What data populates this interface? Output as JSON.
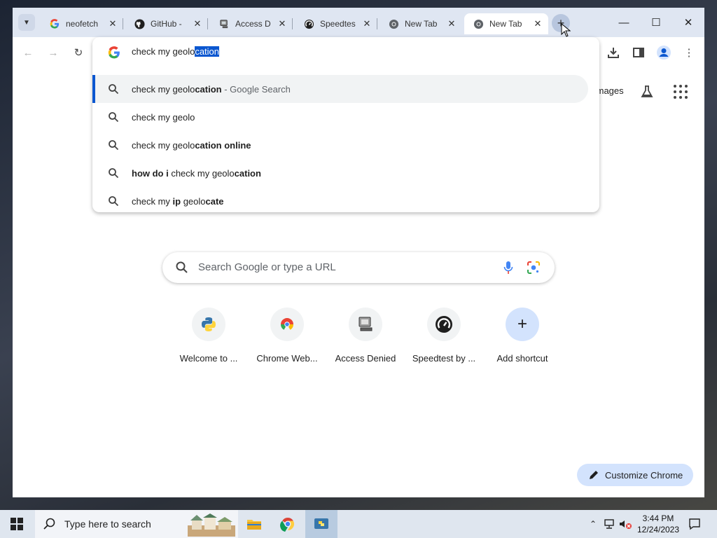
{
  "tabs": [
    {
      "title": "neofetch",
      "icon": "google-icon"
    },
    {
      "title": "GitHub -",
      "icon": "github-icon"
    },
    {
      "title": "Access D",
      "icon": "access-denied-icon"
    },
    {
      "title": "Speedtes",
      "icon": "speedtest-icon"
    },
    {
      "title": "New Tab",
      "icon": "chrome-icon"
    },
    {
      "title": "New Tab",
      "icon": "chrome-icon",
      "active": true
    }
  ],
  "omnibox": {
    "typed": "check my geolo",
    "autocomplete": "cation",
    "suggestions": [
      {
        "segments": [
          {
            "t": "check my geolo",
            "b": false
          },
          {
            "t": "cation",
            "b": true
          }
        ],
        "suffix": " - Google Search",
        "highlighted": true
      },
      {
        "segments": [
          {
            "t": "check my geolo",
            "b": false
          }
        ],
        "suffix": ""
      },
      {
        "segments": [
          {
            "t": "check my geolo",
            "b": false
          },
          {
            "t": "cation online",
            "b": true
          }
        ],
        "suffix": ""
      },
      {
        "segments": [
          {
            "t": "how do i",
            "b": true
          },
          {
            "t": " check my geolo",
            "b": false
          },
          {
            "t": "cation",
            "b": true
          }
        ],
        "suffix": ""
      },
      {
        "segments": [
          {
            "t": "check my ",
            "b": false
          },
          {
            "t": "ip",
            "b": true
          },
          {
            "t": " geolo",
            "b": false
          },
          {
            "t": "cate",
            "b": true
          }
        ],
        "suffix": ""
      }
    ]
  },
  "ntp": {
    "images_link": "Images",
    "search_placeholder": "Search Google or type a URL",
    "shortcuts": [
      {
        "label": "Welcome to ...",
        "icon": "python-icon"
      },
      {
        "label": "Chrome Web...",
        "icon": "chrome-web-store-icon"
      },
      {
        "label": "Access Denied",
        "icon": "access-denied-icon"
      },
      {
        "label": "Speedtest by ...",
        "icon": "speedtest-icon"
      },
      {
        "label": "Add shortcut",
        "icon": "plus-icon"
      }
    ],
    "customize_label": "Customize Chrome"
  },
  "taskbar": {
    "search_placeholder": "Type here to search",
    "time": "3:44 PM",
    "date": "12/24/2023"
  }
}
